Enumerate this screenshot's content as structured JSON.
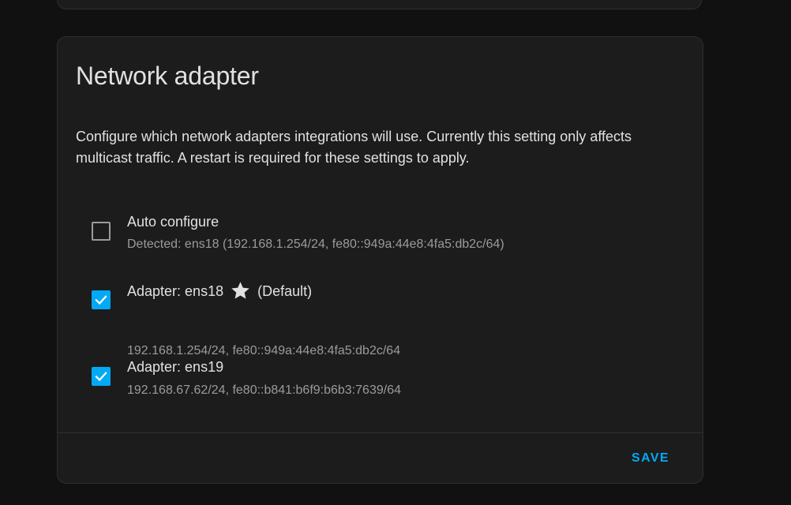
{
  "card": {
    "title": "Network adapter",
    "description": "Configure which network adapters integrations will use. Currently this setting only affects multicast traffic. A restart is required for these settings to apply."
  },
  "adapters": [
    {
      "label": "Auto configure",
      "sublabel": "Detected: ens18 (192.168.1.254/24, fe80::949a:44e8:4fa5:db2c/64)",
      "checked": false,
      "default": false
    },
    {
      "label": "Adapter: ens18",
      "default_label": "(Default)",
      "sublabel": "192.168.1.254/24, fe80::949a:44e8:4fa5:db2c/64",
      "checked": true,
      "default": true,
      "icon": "star-icon"
    },
    {
      "label": "Adapter: ens19",
      "sublabel": "192.168.67.62/24, fe80::b841:b6f9:b6b3:7639/64",
      "checked": true,
      "default": false
    }
  ],
  "actions": {
    "save_label": "SAVE"
  },
  "colors": {
    "accent": "#03a9f4",
    "background": "#111111",
    "card": "#1c1c1c",
    "text_primary": "#e1e1e1",
    "text_secondary": "#9b9b9b"
  }
}
